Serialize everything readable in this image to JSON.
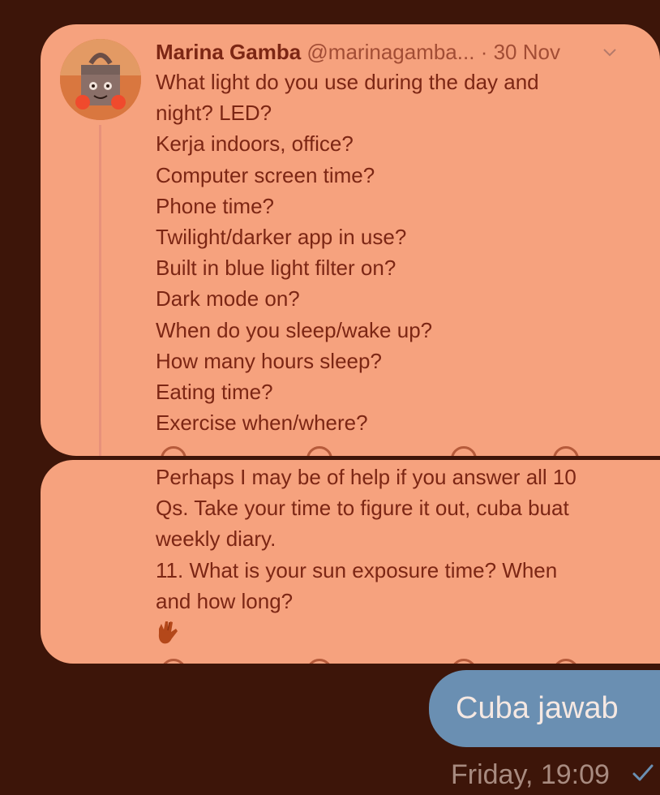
{
  "tweet": {
    "author_name": "Marina Gamba",
    "handle": "@marinagamba...",
    "separator": "·",
    "date": "30 Nov",
    "lines": [
      "What light do you use during the day and",
      "night? LED?",
      "Kerja indoors, office?",
      "Computer screen time?",
      "Phone time?",
      "Twilight/darker app in use?",
      "Built in blue light filter on?",
      "Dark mode on?",
      "When do you sleep/wake up?",
      "How many hours sleep?",
      "Eating time?",
      "Exercise when/where?"
    ]
  },
  "reply": {
    "lines": [
      "Perhaps I may be of help if you answer all 10",
      "Qs. Take your time to figure it out, cuba buat",
      "weekly diary.",
      "11. What is your sun exposure time? When",
      "and how long?"
    ],
    "emoji": "vulcan-salute"
  },
  "message": {
    "text": "Cuba jawab",
    "time": "Friday, 19:09",
    "status_icon": "check-icon"
  },
  "colors": {
    "background": "#3d1509",
    "card": "#f6a27e",
    "text": "#7c2614",
    "bubble": "#6a8fb2",
    "check": "#6a8fb2"
  }
}
